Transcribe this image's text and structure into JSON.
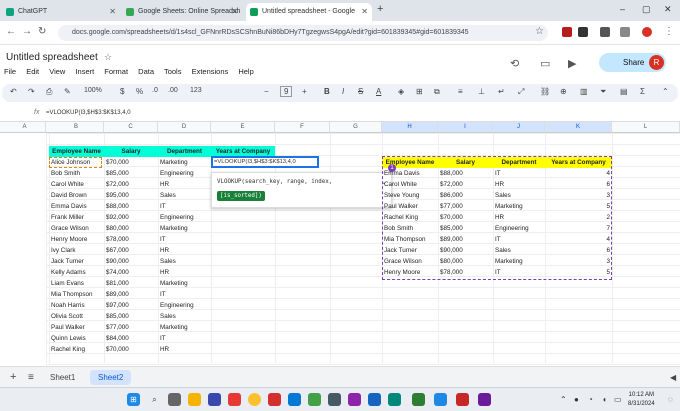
{
  "browser": {
    "tabs": [
      {
        "label": "ChatGPT"
      },
      {
        "label": "Google Sheets: Online Spreadsh"
      },
      {
        "label": "Untitled spreadsheet - Google"
      }
    ],
    "new_tab": "+",
    "url": "docs.google.com/spreadsheets/d/1s4scl_GFNnrRDsSCShnBuNi86bDHy7TgzegwsS4pgA/edit?gid=601839345#gid=601839345"
  },
  "doc": {
    "title": "Untitled spreadsheet",
    "menus": [
      "File",
      "Edit",
      "View",
      "Insert",
      "Format",
      "Data",
      "Tools",
      "Extensions",
      "Help"
    ],
    "share_label": "Share",
    "avatar_letter": "R"
  },
  "toolbar": {
    "zoom": "100%",
    "currency": "$",
    "percent": "%",
    "dec_less": ".0",
    "dec_more": ".00",
    "num_fmt": "123",
    "font_size": "9",
    "minus": "−",
    "plus": "+",
    "bold": "B",
    "italic": "I",
    "strike": "S",
    "text_color": "A"
  },
  "formula_bar": {
    "fx": "fx",
    "content": "=VLOOKUP(I3,$H$3:$K$13,4,0"
  },
  "columns": [
    "A",
    "B",
    "C",
    "D",
    "E",
    "F",
    "G",
    "H",
    "I",
    "J",
    "K",
    "L"
  ],
  "left_table": {
    "headers": [
      "Employee Name",
      "Salary",
      "Department",
      "Years at Company"
    ],
    "rows": [
      [
        "Alice Johnson",
        "$70,000",
        "Marketing"
      ],
      [
        "Bob Smith",
        "$85,000",
        "Engineering"
      ],
      [
        "Carol White",
        "$72,000",
        "HR"
      ],
      [
        "David Brown",
        "$95,000",
        "Sales"
      ],
      [
        "Emma Davis",
        "$88,000",
        "IT"
      ],
      [
        "Frank Miller",
        "$92,000",
        "Engineering"
      ],
      [
        "Grace Wilson",
        "$80,000",
        "Marketing"
      ],
      [
        "Henry Moore",
        "$78,000",
        "IT"
      ],
      [
        "Ivy Clark",
        "$67,000",
        "HR"
      ],
      [
        "Jack Turner",
        "$90,000",
        "Sales"
      ],
      [
        "Kelly Adams",
        "$74,000",
        "HR"
      ],
      [
        "Liam Evans",
        "$81,000",
        "Marketing"
      ],
      [
        "Mia Thompson",
        "$89,000",
        "IT"
      ],
      [
        "Noah Harris",
        "$97,000",
        "Engineering"
      ],
      [
        "Olivia Scott",
        "$85,000",
        "Sales"
      ],
      [
        "Paul Walker",
        "$77,000",
        "Marketing"
      ],
      [
        "Quinn Lewis",
        "$84,000",
        "IT"
      ],
      [
        "Rachel King",
        "$70,000",
        "HR"
      ]
    ]
  },
  "active_cell_text": "=VLOOKUP(I3,$H$3:$K$13,4,0",
  "tooltip": {
    "signature": "VLOOKUP(search_key, range, index,",
    "optional": "[is_sorted])",
    "chevron": "⌄"
  },
  "right_table": {
    "headers": [
      "Employee Name",
      "Salary",
      "Department",
      "Years at Company"
    ],
    "rows": [
      [
        "Emma Davis",
        "$88,000",
        "IT",
        "4"
      ],
      [
        "Carol White",
        "$72,000",
        "HR",
        "6"
      ],
      [
        "Steve Young",
        "$86,000",
        "Sales",
        "3"
      ],
      [
        "Paul Walker",
        "$77,000",
        "Marketing",
        "5"
      ],
      [
        "Rachel King",
        "$70,000",
        "HR",
        "2"
      ],
      [
        "Bob Smith",
        "$85,000",
        "Engineering",
        "7"
      ],
      [
        "Mia Thompson",
        "$89,000",
        "IT",
        "4"
      ],
      [
        "Jack Turner",
        "$90,000",
        "Sales",
        "6"
      ],
      [
        "Grace Wilson",
        "$80,000",
        "Marketing",
        "3"
      ],
      [
        "Henry Moore",
        "$78,000",
        "IT",
        "5"
      ]
    ]
  },
  "ref_badge": "1",
  "sheets": [
    "Sheet1",
    "Sheet2"
  ],
  "active_sheet": "Sheet2",
  "clock": {
    "time": "10:12 AM",
    "date": "8/31/2024"
  },
  "colors": {
    "cyan_header": "#00ffd7",
    "yellow_header": "#ffff00",
    "accent": "#1a73e8",
    "share_bg": "#c2e7ff"
  }
}
